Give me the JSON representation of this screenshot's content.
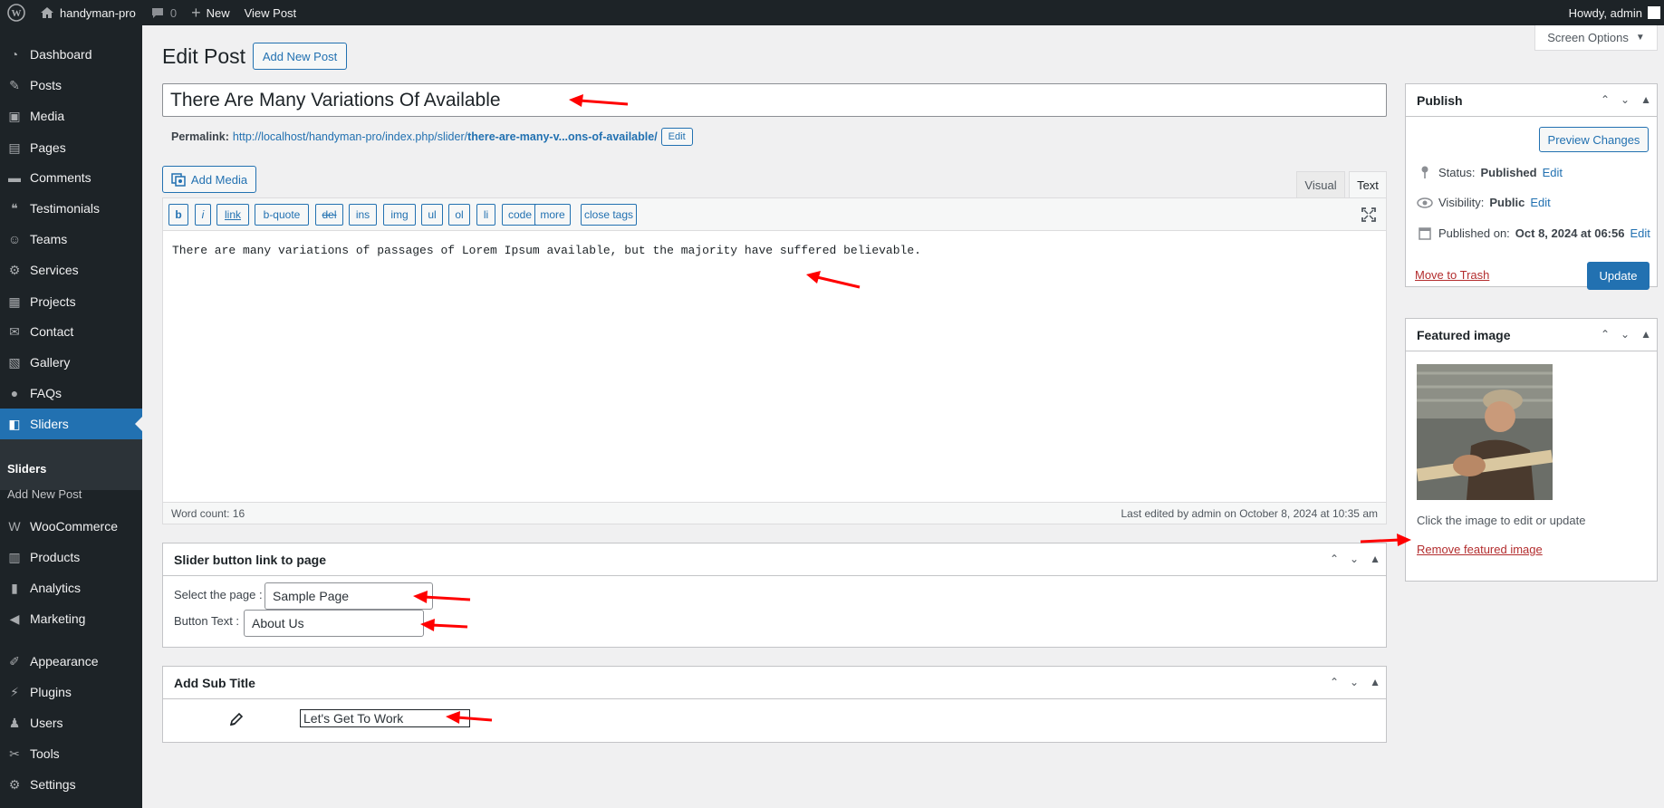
{
  "admin_bar": {
    "site_name": "handyman-pro",
    "comments_count": "0",
    "new_label": "New",
    "view_post_label": "View Post",
    "howdy": "Howdy, admin"
  },
  "sidebar": {
    "items": [
      {
        "label": "Dashboard",
        "icon": "dashboard-icon"
      },
      {
        "label": "Posts",
        "icon": "pin-icon"
      },
      {
        "label": "Media",
        "icon": "media-icon"
      },
      {
        "label": "Pages",
        "icon": "pages-icon"
      },
      {
        "label": "Comments",
        "icon": "comment-icon"
      },
      {
        "label": "Testimonials",
        "icon": "testimonial-icon"
      },
      {
        "label": "Teams",
        "icon": "groups-icon"
      },
      {
        "label": "Services",
        "icon": "gear-icon"
      },
      {
        "label": "Projects",
        "icon": "grid-icon"
      },
      {
        "label": "Contact",
        "icon": "email-icon"
      },
      {
        "label": "Gallery",
        "icon": "gallery-icon"
      },
      {
        "label": "FAQs",
        "icon": "chat-icon"
      },
      {
        "label": "Sliders",
        "icon": "slides-icon"
      },
      {
        "label": "WooCommerce",
        "icon": "woo-icon"
      },
      {
        "label": "Products",
        "icon": "archive-icon"
      },
      {
        "label": "Analytics",
        "icon": "chart-icon"
      },
      {
        "label": "Marketing",
        "icon": "megaphone-icon"
      },
      {
        "label": "Appearance",
        "icon": "brush-icon"
      },
      {
        "label": "Plugins",
        "icon": "plug-icon"
      },
      {
        "label": "Users",
        "icon": "user-icon"
      },
      {
        "label": "Tools",
        "icon": "wrench-icon"
      },
      {
        "label": "Settings",
        "icon": "settings-icon"
      }
    ],
    "submenu": [
      "Sliders",
      "Add New Post"
    ]
  },
  "page": {
    "title": "Edit Post",
    "add_new_label": "Add New Post",
    "screen_options": "Screen Options"
  },
  "post": {
    "title": "There Are Many Variations Of Available",
    "permalink_label": "Permalink:",
    "permalink_base": "http://localhost/handyman-pro/index.php/slider/",
    "permalink_slug": "there-are-many-v...ons-of-available/",
    "permalink_edit": "Edit"
  },
  "editor": {
    "add_media": "Add Media",
    "tab_visual": "Visual",
    "tab_text": "Text",
    "buttons": [
      "b",
      "i",
      "link",
      "b-quote",
      "del",
      "ins",
      "img",
      "ul",
      "ol",
      "li",
      "code",
      "more",
      "close tags"
    ],
    "content": "There are many variations of passages of Lorem Ipsum available, but the majority have suffered believable.",
    "word_count": "Word count: 16",
    "last_edited": "Last edited by admin on October 8, 2024 at 10:35 am"
  },
  "slider_link_box": {
    "title": "Slider button link to page",
    "select_label": "Select the page :",
    "select_value": "Sample Page",
    "button_text_label": "Button Text :",
    "button_text_value": "About Us"
  },
  "subtitle_box": {
    "title": "Add Sub Title",
    "value": "Let's Get To Work"
  },
  "publish_box": {
    "title": "Publish",
    "preview": "Preview Changes",
    "status_label": "Status:",
    "status_value": "Published",
    "visibility_label": "Visibility:",
    "visibility_value": "Public",
    "published_label": "Published on:",
    "published_value": "Oct 8, 2024 at 06:56",
    "edit": "Edit",
    "trash": "Move to Trash",
    "update": "Update"
  },
  "featured_box": {
    "title": "Featured image",
    "hint": "Click the image to edit or update",
    "remove": "Remove featured image"
  },
  "colors": {
    "admin_dark": "#1d2327",
    "accent": "#2271b1",
    "annotation_arrow": "#ff0000"
  }
}
